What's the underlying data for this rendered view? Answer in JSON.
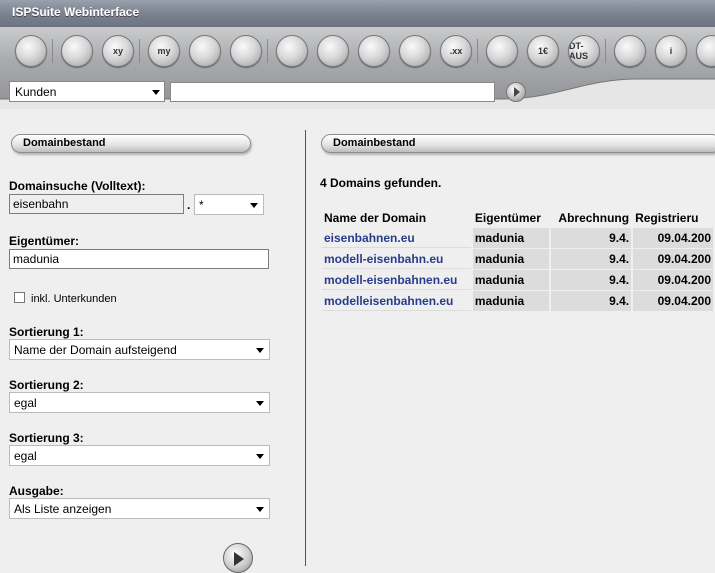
{
  "app": {
    "title": "ISPSuite Webinterface"
  },
  "toolbar": {
    "icons": [
      {
        "name": "home-icon",
        "label": ""
      },
      {
        "name": "shop-icon",
        "label": ""
      },
      {
        "name": "tasks-icon",
        "label": "xy"
      },
      {
        "name": "my-user-icon",
        "label": "my"
      },
      {
        "name": "user-icon",
        "label": ""
      },
      {
        "name": "users-icon",
        "label": ""
      },
      {
        "name": "structure-icon",
        "label": ""
      },
      {
        "name": "box-icon",
        "label": ""
      },
      {
        "name": "servers-icon",
        "label": ""
      },
      {
        "name": "pyramid-icon",
        "label": ""
      },
      {
        "name": "domain-icon",
        "label": ".xx"
      },
      {
        "name": "document-icon",
        "label": ""
      },
      {
        "name": "invoice-icon",
        "label": "1€"
      },
      {
        "name": "dtaus-icon",
        "label": "DT-AUS"
      },
      {
        "name": "settings-icon",
        "label": ""
      },
      {
        "name": "info-icon",
        "label": "i"
      },
      {
        "name": "plugin-icon",
        "label": ""
      }
    ]
  },
  "search": {
    "scope": "Kunden",
    "query": ""
  },
  "left": {
    "title": "Domainbestand",
    "fulltext_label": "Domainsuche (Volltext):",
    "fulltext_value": "eisenbahn",
    "tld_dot": ".",
    "tld_value": "*",
    "owner_label": "Eigentümer:",
    "owner_value": "madunia",
    "subcustomers_label": "inkl. Unterkunden",
    "sort1_label": "Sortierung 1:",
    "sort1_value": "Name der Domain aufsteigend",
    "sort2_label": "Sortierung 2:",
    "sort2_value": "egal",
    "sort3_label": "Sortierung 3:",
    "sort3_value": "egal",
    "output_label": "Ausgabe:",
    "output_value": "Als Liste anzeigen"
  },
  "right": {
    "title": "Domainbestand",
    "found": "4 Domains gefunden.",
    "columns": [
      "Name der Domain",
      "Eigentümer",
      "Abrechnung",
      "Registrieru"
    ],
    "rows": [
      {
        "name": "eisenbahnen.eu",
        "owner": "madunia",
        "billing": "9.4.",
        "registered": "09.04.200"
      },
      {
        "name": "modell-eisenbahn.eu",
        "owner": "madunia",
        "billing": "9.4.",
        "registered": "09.04.200"
      },
      {
        "name": "modell-eisenbahnen.eu",
        "owner": "madunia",
        "billing": "9.4.",
        "registered": "09.04.200"
      },
      {
        "name": "modelleisenbahnen.eu",
        "owner": "madunia",
        "billing": "9.4.",
        "registered": "09.04.200"
      }
    ]
  }
}
